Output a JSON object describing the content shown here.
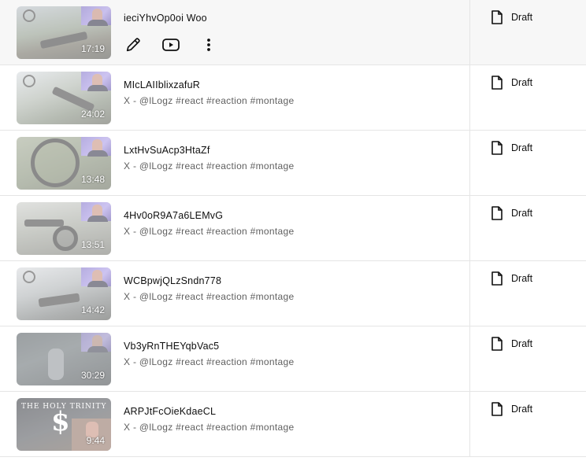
{
  "rows": [
    {
      "title": "ieciYhvOp0oi Woo",
      "description": "",
      "duration": "17:19",
      "visibility": "Draft",
      "hovered": true,
      "actions": [
        {
          "icon": "pencil-icon"
        },
        {
          "icon": "youtube-icon"
        },
        {
          "icon": "more-vert-icon"
        }
      ]
    },
    {
      "title": "MIcLAIIblixzafuR",
      "description": "X - @lLogz #react #reaction #montage",
      "duration": "24:02",
      "visibility": "Draft"
    },
    {
      "title": "LxtHvSuAcp3HtaZf",
      "description": "X - @lLogz #react #reaction #montage",
      "duration": "13:48",
      "visibility": "Draft"
    },
    {
      "title": "4Hv0oR9A7a6LEMvG",
      "description": "X - @lLogz #react #reaction #montage",
      "duration": "13:51",
      "visibility": "Draft"
    },
    {
      "title": "WCBpwjQLzSndn778",
      "description": "X - @lLogz #react #reaction #montage",
      "duration": "14:42",
      "visibility": "Draft"
    },
    {
      "title": "Vb3yRnTHEYqbVac5",
      "description": "X - @lLogz #react #reaction #montage",
      "duration": "30:29",
      "visibility": "Draft"
    },
    {
      "title": "ARPJtFcOieKdaeCL",
      "description": "X - @lLogz #react #reaction #montage",
      "duration": "9:44",
      "visibility": "Draft",
      "thumb_text": "THE HOLY TRINITY"
    }
  ]
}
